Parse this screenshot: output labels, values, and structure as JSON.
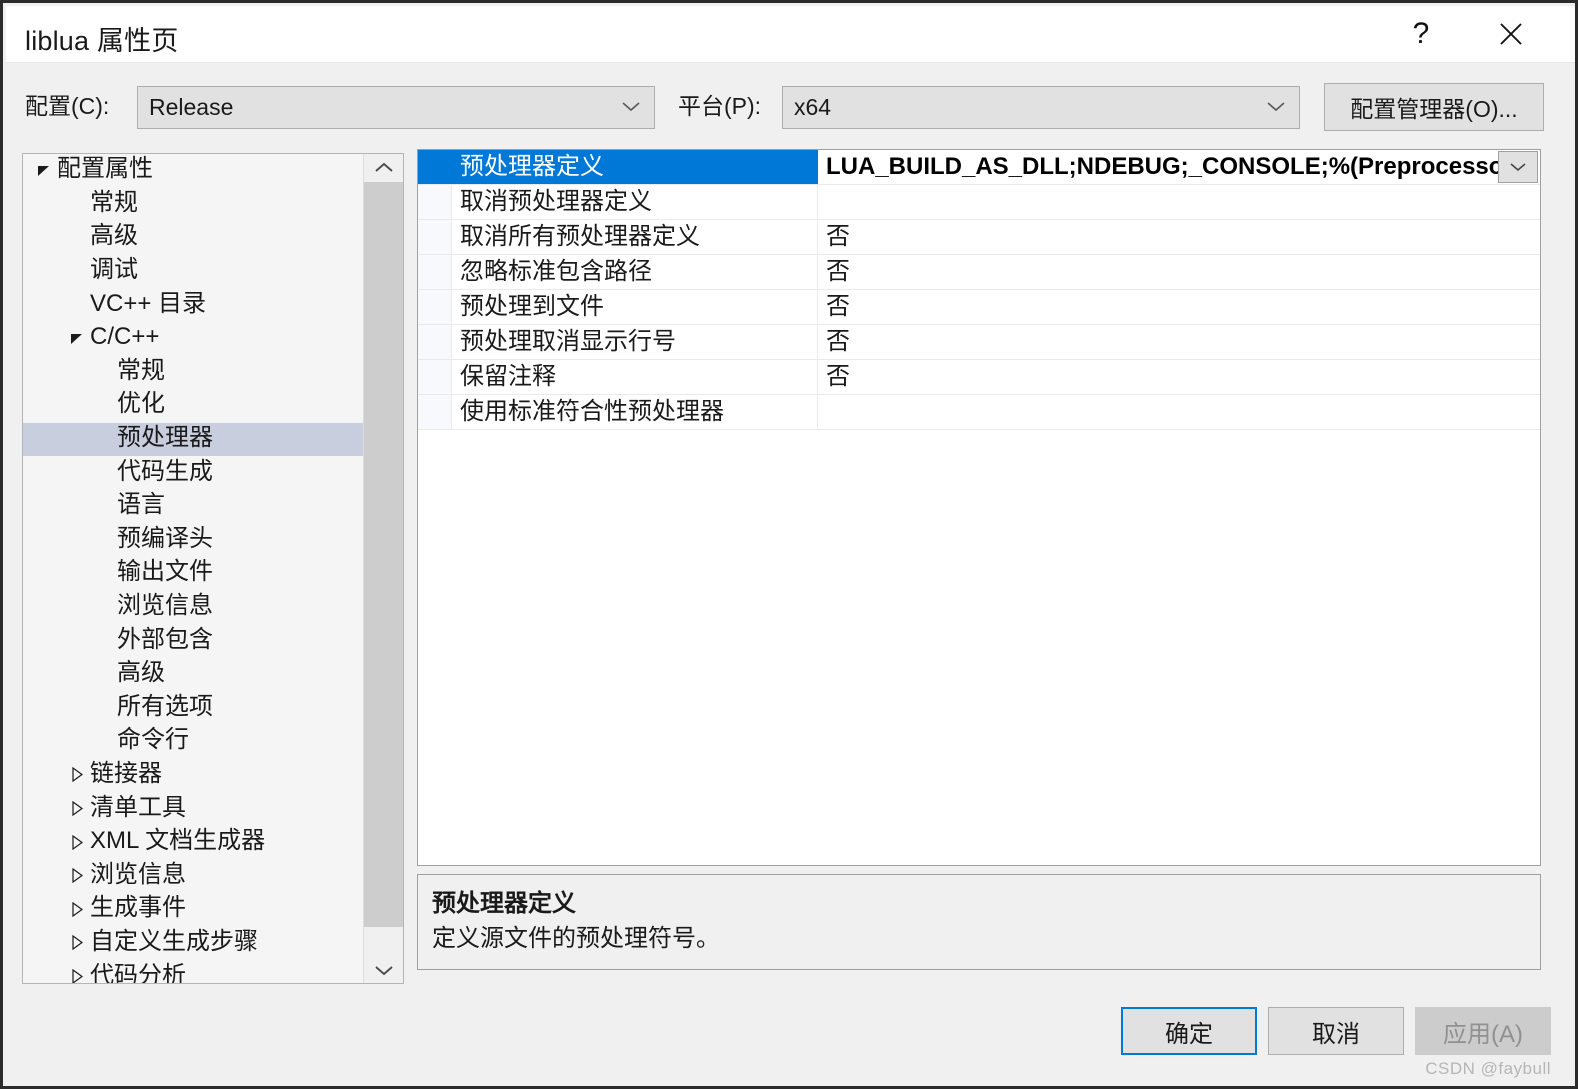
{
  "window": {
    "title": "liblua 属性页",
    "help_icon": "question-mark-icon",
    "close_icon": "close-x-icon"
  },
  "header": {
    "configuration_label": "配置(C):",
    "configuration_value": "Release",
    "platform_label": "平台(P):",
    "platform_value": "x64",
    "config_manager_button": "配置管理器(O)..."
  },
  "tree": {
    "selected": "预处理器",
    "items": [
      {
        "label": "配置属性",
        "depth": 0,
        "twisty": "expanded"
      },
      {
        "label": "常规",
        "depth": 1,
        "twisty": "none"
      },
      {
        "label": "高级",
        "depth": 1,
        "twisty": "none"
      },
      {
        "label": "调试",
        "depth": 1,
        "twisty": "none"
      },
      {
        "label": "VC++ 目录",
        "depth": 1,
        "twisty": "none"
      },
      {
        "label": "C/C++",
        "depth": 1,
        "twisty": "expanded"
      },
      {
        "label": "常规",
        "depth": 2,
        "twisty": "none"
      },
      {
        "label": "优化",
        "depth": 2,
        "twisty": "none"
      },
      {
        "label": "预处理器",
        "depth": 2,
        "twisty": "none",
        "selected": true
      },
      {
        "label": "代码生成",
        "depth": 2,
        "twisty": "none"
      },
      {
        "label": "语言",
        "depth": 2,
        "twisty": "none"
      },
      {
        "label": "预编译头",
        "depth": 2,
        "twisty": "none"
      },
      {
        "label": "输出文件",
        "depth": 2,
        "twisty": "none"
      },
      {
        "label": "浏览信息",
        "depth": 2,
        "twisty": "none"
      },
      {
        "label": "外部包含",
        "depth": 2,
        "twisty": "none"
      },
      {
        "label": "高级",
        "depth": 2,
        "twisty": "none"
      },
      {
        "label": "所有选项",
        "depth": 2,
        "twisty": "none"
      },
      {
        "label": "命令行",
        "depth": 2,
        "twisty": "none"
      },
      {
        "label": "链接器",
        "depth": 1,
        "twisty": "collapsed"
      },
      {
        "label": "清单工具",
        "depth": 1,
        "twisty": "collapsed"
      },
      {
        "label": "XML 文档生成器",
        "depth": 1,
        "twisty": "collapsed"
      },
      {
        "label": "浏览信息",
        "depth": 1,
        "twisty": "collapsed"
      },
      {
        "label": "生成事件",
        "depth": 1,
        "twisty": "collapsed"
      },
      {
        "label": "自定义生成步骤",
        "depth": 1,
        "twisty": "collapsed"
      },
      {
        "label": "代码分析",
        "depth": 1,
        "twisty": "collapsed"
      }
    ],
    "scroll_up_icon": "chevron-up-icon",
    "scroll_down_icon": "chevron-down-icon"
  },
  "grid": {
    "dropdown_icon": "chevron-down-icon",
    "rows": [
      {
        "name": "预处理器定义",
        "value": "LUA_BUILD_AS_DLL;NDEBUG;_CONSOLE;%(PreprocessorD",
        "selected": true,
        "has_dropdown": true
      },
      {
        "name": "取消预处理器定义",
        "value": ""
      },
      {
        "name": "取消所有预处理器定义",
        "value": "否"
      },
      {
        "name": "忽略标准包含路径",
        "value": "否"
      },
      {
        "name": "预处理到文件",
        "value": "否"
      },
      {
        "name": "预处理取消显示行号",
        "value": "否"
      },
      {
        "name": "保留注释",
        "value": "否"
      },
      {
        "name": "使用标准符合性预处理器",
        "value": ""
      }
    ]
  },
  "description": {
    "title": "预处理器定义",
    "body": "定义源文件的预处理符号。"
  },
  "footer": {
    "ok_label": "确定",
    "cancel_label": "取消",
    "apply_label": "应用(A)"
  },
  "watermark": "CSDN @faybull",
  "colors": {
    "selection_blue": "#0078D7",
    "tree_selection": "#C9CEDE",
    "dialog_background": "#F0F0F0",
    "grid_background": "#FFFFFF"
  }
}
